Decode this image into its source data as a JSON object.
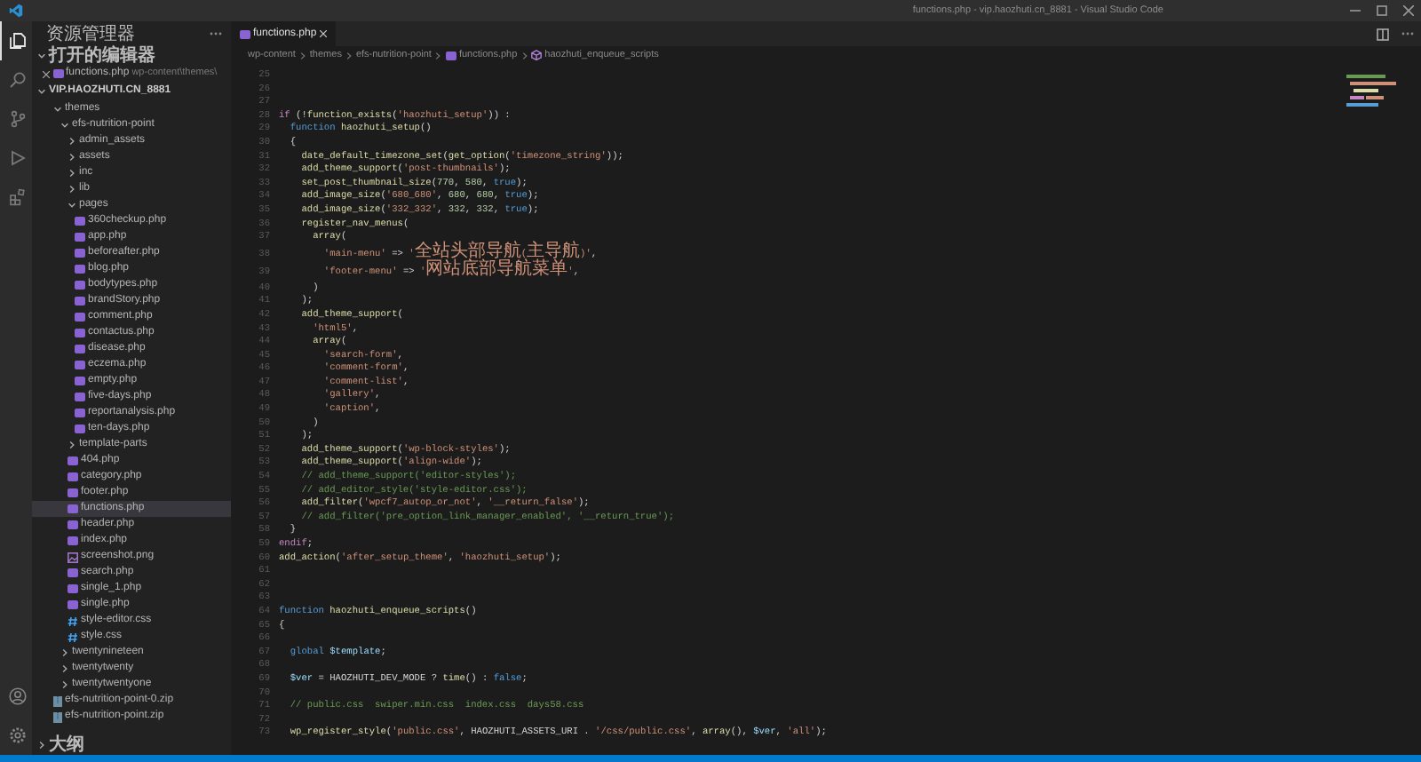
{
  "window": {
    "title": "functions.php - vip.haozhuti.cn_8881 - Visual Studio Code"
  },
  "activity_bar": {
    "items": [
      {
        "kind": "files",
        "selected": true
      },
      {
        "kind": "search",
        "selected": false
      },
      {
        "kind": "source-control",
        "selected": false
      },
      {
        "kind": "debug",
        "selected": false
      },
      {
        "kind": "extensions",
        "selected": false
      }
    ]
  },
  "sidebar": {
    "title": "资源管理器",
    "open_editors": {
      "title": "打开的编辑器",
      "expanded": true,
      "items": [
        {
          "label": "functions.php",
          "description": "wp-content\\themes\\",
          "kind": "php",
          "selected": false
        }
      ]
    },
    "workspace": {
      "title": "VIP.HAOZHUTI.CN_8881",
      "expanded": true,
      "tree": [
        {
          "label": "themes",
          "kind": "folder",
          "expanded": true,
          "selected": false,
          "children": [
            {
              "label": "efs-nutrition-point",
              "kind": "folder",
              "expanded": true,
              "selected": false,
              "children": [
                {
                  "label": "admin_assets",
                  "kind": "folder",
                  "expanded": false,
                  "selected": false
                },
                {
                  "label": "assets",
                  "kind": "folder",
                  "expanded": false,
                  "selected": false
                },
                {
                  "label": "inc",
                  "kind": "folder",
                  "expanded": false,
                  "selected": false
                },
                {
                  "label": "lib",
                  "kind": "folder",
                  "expanded": false,
                  "selected": false
                },
                {
                  "label": "pages",
                  "kind": "folder",
                  "expanded": true,
                  "selected": false,
                  "children": [
                    {
                      "label": "360checkup.php",
                      "kind": "php",
                      "selected": false
                    },
                    {
                      "label": "app.php",
                      "kind": "php",
                      "selected": false
                    },
                    {
                      "label": "beforeafter.php",
                      "kind": "php",
                      "selected": false
                    },
                    {
                      "label": "blog.php",
                      "kind": "php",
                      "selected": false
                    },
                    {
                      "label": "bodytypes.php",
                      "kind": "php",
                      "selected": false
                    },
                    {
                      "label": "brandStory.php",
                      "kind": "php",
                      "selected": false
                    },
                    {
                      "label": "comment.php",
                      "kind": "php",
                      "selected": false
                    },
                    {
                      "label": "contactus.php",
                      "kind": "php",
                      "selected": false
                    },
                    {
                      "label": "disease.php",
                      "kind": "php",
                      "selected": false
                    },
                    {
                      "label": "eczema.php",
                      "kind": "php",
                      "selected": false
                    },
                    {
                      "label": "empty.php",
                      "kind": "php",
                      "selected": false
                    },
                    {
                      "label": "five-days.php",
                      "kind": "php",
                      "selected": false
                    },
                    {
                      "label": "reportanalysis.php",
                      "kind": "php",
                      "selected": false
                    },
                    {
                      "label": "ten-days.php",
                      "kind": "php",
                      "selected": false
                    }
                  ]
                },
                {
                  "label": "template-parts",
                  "kind": "folder",
                  "expanded": false,
                  "selected": false
                },
                {
                  "label": "404.php",
                  "kind": "php",
                  "selected": false
                },
                {
                  "label": "category.php",
                  "kind": "php",
                  "selected": false
                },
                {
                  "label": "footer.php",
                  "kind": "php",
                  "selected": false
                },
                {
                  "label": "functions.php",
                  "kind": "php",
                  "selected": true
                },
                {
                  "label": "header.php",
                  "kind": "php",
                  "selected": false
                },
                {
                  "label": "index.php",
                  "kind": "php",
                  "selected": false
                },
                {
                  "label": "screenshot.png",
                  "kind": "image",
                  "selected": false
                },
                {
                  "label": "search.php",
                  "kind": "php",
                  "selected": false
                },
                {
                  "label": "single_1.php",
                  "kind": "php",
                  "selected": false
                },
                {
                  "label": "single.php",
                  "kind": "php",
                  "selected": false
                },
                {
                  "label": "style-editor.css",
                  "kind": "css",
                  "selected": false
                },
                {
                  "label": "style.css",
                  "kind": "css",
                  "selected": false
                }
              ]
            },
            {
              "label": "twentynineteen",
              "kind": "folder",
              "expanded": false,
              "selected": false
            },
            {
              "label": "twentytwenty",
              "kind": "folder",
              "expanded": false,
              "selected": false
            },
            {
              "label": "twentytwentyone",
              "kind": "folder",
              "expanded": false,
              "selected": false
            }
          ]
        },
        {
          "label": "efs-nutrition-point-0.zip",
          "kind": "zip",
          "selected": false
        },
        {
          "label": "efs-nutrition-point.zip",
          "kind": "zip",
          "selected": false
        }
      ]
    },
    "outline": {
      "title": "大纲",
      "expanded": false
    }
  },
  "editor": {
    "tabs": [
      {
        "label": "functions.php",
        "kind": "php",
        "selected": true
      }
    ],
    "breadcrumb": [
      {
        "label": "wp-content",
        "kind": "folder"
      },
      {
        "label": "themes",
        "kind": "folder"
      },
      {
        "label": "efs-nutrition-point",
        "kind": "folder"
      },
      {
        "label": "functions.php",
        "kind": "php"
      },
      {
        "label": "haozhuti_enqueue_scripts",
        "kind": "method"
      }
    ],
    "lines": [
      {
        "number": "25"
      },
      {
        "number": "26"
      },
      {
        "number": "27"
      },
      {
        "number": "28",
        "tokens": [
          {
            "kind": "control",
            "text": "if"
          },
          {
            "kind": "plain",
            "text": " (!"
          },
          {
            "kind": "function",
            "text": "function_exists"
          },
          {
            "kind": "plain",
            "text": "("
          },
          {
            "kind": "string",
            "text": "'haozhuti_setup'"
          },
          {
            "kind": "plain",
            "text": ")) :"
          }
        ]
      },
      {
        "number": "29",
        "tokens": [
          {
            "kind": "storage",
            "text": "  function"
          },
          {
            "kind": "function",
            "text": " haozhuti_setup"
          },
          {
            "kind": "plain",
            "text": "()"
          }
        ]
      },
      {
        "number": "30",
        "tokens": [
          {
            "kind": "plain",
            "text": "  {"
          }
        ]
      },
      {
        "number": "31",
        "tokens": [
          {
            "kind": "function",
            "text": "    date_default_timezone_set"
          },
          {
            "kind": "plain",
            "text": "("
          },
          {
            "kind": "function",
            "text": "get_option"
          },
          {
            "kind": "plain",
            "text": "("
          },
          {
            "kind": "string",
            "text": "'timezone_string'"
          },
          {
            "kind": "plain",
            "text": "));"
          }
        ]
      },
      {
        "number": "32",
        "tokens": [
          {
            "kind": "function",
            "text": "    add_theme_support"
          },
          {
            "kind": "plain",
            "text": "("
          },
          {
            "kind": "string",
            "text": "'post-thumbnails'"
          },
          {
            "kind": "plain",
            "text": ");"
          }
        ]
      },
      {
        "number": "33",
        "tokens": [
          {
            "kind": "function",
            "text": "    set_post_thumbnail_size"
          },
          {
            "kind": "plain",
            "text": "("
          },
          {
            "kind": "number",
            "text": "770"
          },
          {
            "kind": "plain",
            "text": ", "
          },
          {
            "kind": "number",
            "text": "580"
          },
          {
            "kind": "plain",
            "text": ", "
          },
          {
            "kind": "storage",
            "text": "true"
          },
          {
            "kind": "plain",
            "text": ");"
          }
        ]
      },
      {
        "number": "34",
        "tokens": [
          {
            "kind": "function",
            "text": "    add_image_size"
          },
          {
            "kind": "plain",
            "text": "("
          },
          {
            "kind": "string",
            "text": "'680_680'"
          },
          {
            "kind": "plain",
            "text": ", "
          },
          {
            "kind": "number",
            "text": "680"
          },
          {
            "kind": "plain",
            "text": ", "
          },
          {
            "kind": "number",
            "text": "680"
          },
          {
            "kind": "plain",
            "text": ", "
          },
          {
            "kind": "storage",
            "text": "true"
          },
          {
            "kind": "plain",
            "text": ");"
          }
        ]
      },
      {
        "number": "35",
        "tokens": [
          {
            "kind": "function",
            "text": "    add_image_size"
          },
          {
            "kind": "plain",
            "text": "("
          },
          {
            "kind": "string",
            "text": "'332_332'"
          },
          {
            "kind": "plain",
            "text": ", "
          },
          {
            "kind": "number",
            "text": "332"
          },
          {
            "kind": "plain",
            "text": ", "
          },
          {
            "kind": "number",
            "text": "332"
          },
          {
            "kind": "plain",
            "text": ", "
          },
          {
            "kind": "storage",
            "text": "true"
          },
          {
            "kind": "plain",
            "text": ");"
          }
        ]
      },
      {
        "number": "36",
        "tokens": [
          {
            "kind": "function",
            "text": "    register_nav_menus"
          },
          {
            "kind": "plain",
            "text": "("
          }
        ]
      },
      {
        "number": "37",
        "tokens": [
          {
            "kind": "function",
            "text": "      array"
          },
          {
            "kind": "plain",
            "text": "("
          }
        ]
      },
      {
        "number": "38",
        "tokens": [
          {
            "kind": "string",
            "text": "        'main-menu'"
          },
          {
            "kind": "plain",
            "text": " => "
          },
          {
            "kind": "string",
            "text": "'全站头部导航(主导航)'"
          },
          {
            "kind": "plain",
            "text": ","
          }
        ]
      },
      {
        "number": "39",
        "tokens": [
          {
            "kind": "string",
            "text": "        'footer-menu'"
          },
          {
            "kind": "plain",
            "text": " => "
          },
          {
            "kind": "string",
            "text": "'网站底部导航菜单'"
          },
          {
            "kind": "plain",
            "text": ","
          }
        ]
      },
      {
        "number": "40",
        "tokens": [
          {
            "kind": "plain",
            "text": "      )"
          }
        ]
      },
      {
        "number": "41",
        "tokens": [
          {
            "kind": "plain",
            "text": "    );"
          }
        ]
      },
      {
        "number": "42",
        "tokens": [
          {
            "kind": "function",
            "text": "    add_theme_support"
          },
          {
            "kind": "plain",
            "text": "("
          }
        ]
      },
      {
        "number": "43",
        "tokens": [
          {
            "kind": "string",
            "text": "      'html5'"
          },
          {
            "kind": "plain",
            "text": ","
          }
        ]
      },
      {
        "number": "44",
        "tokens": [
          {
            "kind": "function",
            "text": "      array"
          },
          {
            "kind": "plain",
            "text": "("
          }
        ]
      },
      {
        "number": "45",
        "tokens": [
          {
            "kind": "string",
            "text": "        'search-form'"
          },
          {
            "kind": "plain",
            "text": ","
          }
        ]
      },
      {
        "number": "46",
        "tokens": [
          {
            "kind": "string",
            "text": "        'comment-form'"
          },
          {
            "kind": "plain",
            "text": ","
          }
        ]
      },
      {
        "number": "47",
        "tokens": [
          {
            "kind": "string",
            "text": "        'comment-list'"
          },
          {
            "kind": "plain",
            "text": ","
          }
        ]
      },
      {
        "number": "48",
        "tokens": [
          {
            "kind": "string",
            "text": "        'gallery'"
          },
          {
            "kind": "plain",
            "text": ","
          }
        ]
      },
      {
        "number": "49",
        "tokens": [
          {
            "kind": "string",
            "text": "        'caption'"
          },
          {
            "kind": "plain",
            "text": ","
          }
        ]
      },
      {
        "number": "50",
        "tokens": [
          {
            "kind": "plain",
            "text": "      )"
          }
        ]
      },
      {
        "number": "51",
        "tokens": [
          {
            "kind": "plain",
            "text": "    );"
          }
        ]
      },
      {
        "number": "52",
        "tokens": [
          {
            "kind": "function",
            "text": "    add_theme_support"
          },
          {
            "kind": "plain",
            "text": "("
          },
          {
            "kind": "string",
            "text": "'wp-block-styles'"
          },
          {
            "kind": "plain",
            "text": ");"
          }
        ]
      },
      {
        "number": "53",
        "tokens": [
          {
            "kind": "function",
            "text": "    add_theme_support"
          },
          {
            "kind": "plain",
            "text": "("
          },
          {
            "kind": "string",
            "text": "'align-wide'"
          },
          {
            "kind": "plain",
            "text": ");"
          }
        ]
      },
      {
        "number": "54",
        "tokens": [
          {
            "kind": "comment",
            "text": "    // add_theme_support('editor-styles');"
          }
        ]
      },
      {
        "number": "55",
        "tokens": [
          {
            "kind": "comment",
            "text": "    // add_editor_style('style-editor.css');"
          }
        ]
      },
      {
        "number": "56",
        "tokens": [
          {
            "kind": "function",
            "text": "    add_filter"
          },
          {
            "kind": "plain",
            "text": "("
          },
          {
            "kind": "string",
            "text": "'wpcf7_autop_or_not'"
          },
          {
            "kind": "plain",
            "text": ", "
          },
          {
            "kind": "string",
            "text": "'__return_false'"
          },
          {
            "kind": "plain",
            "text": ");"
          }
        ]
      },
      {
        "number": "57",
        "tokens": [
          {
            "kind": "comment",
            "text": "    // add_filter('pre_option_link_manager_enabled', '__return_true');"
          }
        ]
      },
      {
        "number": "58",
        "tokens": [
          {
            "kind": "plain",
            "text": "  }"
          }
        ]
      },
      {
        "number": "59",
        "tokens": [
          {
            "kind": "control",
            "text": "endif"
          },
          {
            "kind": "plain",
            "text": ";"
          }
        ]
      },
      {
        "number": "60",
        "tokens": [
          {
            "kind": "function",
            "text": "add_action"
          },
          {
            "kind": "plain",
            "text": "("
          },
          {
            "kind": "string",
            "text": "'after_setup_theme'"
          },
          {
            "kind": "plain",
            "text": ", "
          },
          {
            "kind": "string",
            "text": "'haozhuti_setup'"
          },
          {
            "kind": "plain",
            "text": ");"
          }
        ]
      },
      {
        "number": "61"
      },
      {
        "number": "62"
      },
      {
        "number": "63"
      },
      {
        "number": "64",
        "tokens": [
          {
            "kind": "storage",
            "text": "function"
          },
          {
            "kind": "function",
            "text": " haozhuti_enqueue_scripts"
          },
          {
            "kind": "plain",
            "text": "()"
          }
        ]
      },
      {
        "number": "65",
        "tokens": [
          {
            "kind": "plain",
            "text": "{"
          }
        ]
      },
      {
        "number": "66"
      },
      {
        "number": "67",
        "tokens": [
          {
            "kind": "storage",
            "text": "  global"
          },
          {
            "kind": "variable",
            "text": " $template"
          },
          {
            "kind": "plain",
            "text": ";"
          }
        ]
      },
      {
        "number": "68"
      },
      {
        "number": "69",
        "tokens": [
          {
            "kind": "variable",
            "text": "  $ver"
          },
          {
            "kind": "plain",
            "text": " = HAOZHUTI_DEV_MODE ? "
          },
          {
            "kind": "function",
            "text": "time"
          },
          {
            "kind": "plain",
            "text": "() : "
          },
          {
            "kind": "storage",
            "text": "false"
          },
          {
            "kind": "plain",
            "text": ";"
          }
        ]
      },
      {
        "number": "70"
      },
      {
        "number": "71",
        "tokens": [
          {
            "kind": "comment",
            "text": "  // public.css  swiper.min.css  index.css  days58.css"
          }
        ]
      },
      {
        "number": "72"
      },
      {
        "number": "73",
        "tokens": [
          {
            "kind": "function",
            "text": "  wp_register_style"
          },
          {
            "kind": "plain",
            "text": "("
          },
          {
            "kind": "string",
            "text": "'public.css'"
          },
          {
            "kind": "plain",
            "text": ", HAOZHUTI_ASSETS_URI . "
          },
          {
            "kind": "string",
            "text": "'/css/public.css'"
          },
          {
            "kind": "plain",
            "text": ", "
          },
          {
            "kind": "function",
            "text": "array"
          },
          {
            "kind": "plain",
            "text": "(), "
          },
          {
            "kind": "variable",
            "text": "$ver"
          },
          {
            "kind": "plain",
            "text": ", "
          },
          {
            "kind": "string",
            "text": "'all'"
          },
          {
            "kind": "plain",
            "text": ");"
          }
        ]
      }
    ]
  }
}
